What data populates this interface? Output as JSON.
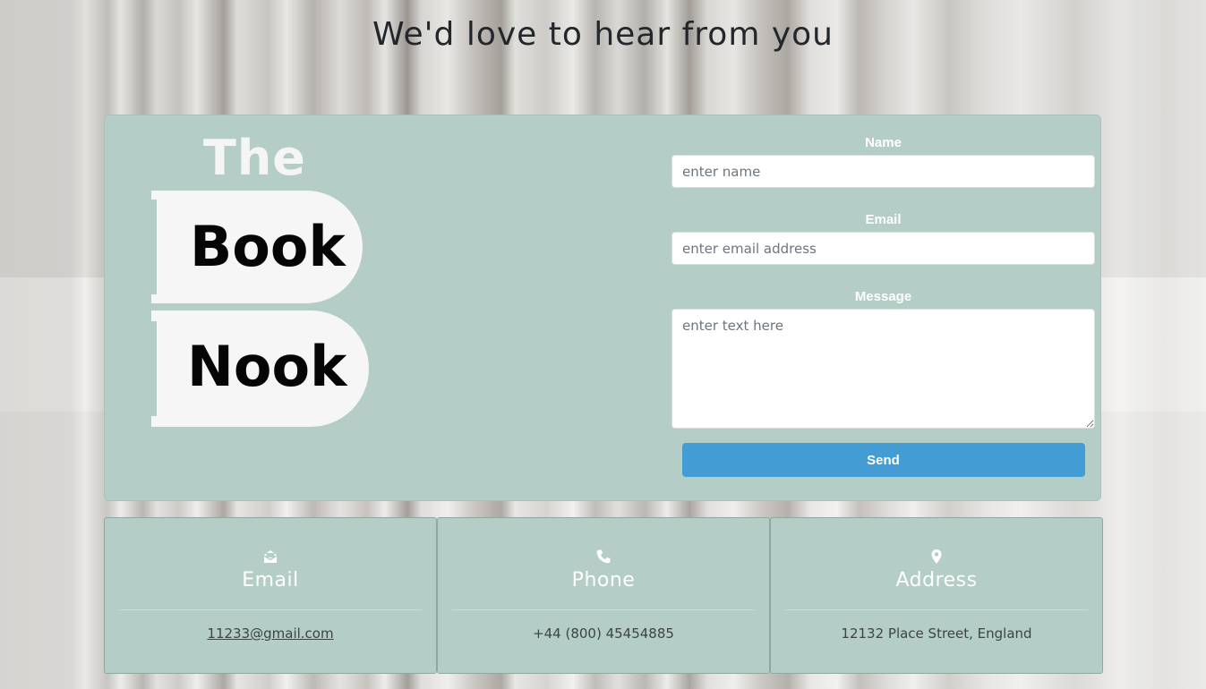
{
  "page": {
    "title": "We'd love to hear from you"
  },
  "logo": {
    "line1": "The",
    "line2": "Book",
    "line3": "Nook"
  },
  "form": {
    "name_label": "Name",
    "name_placeholder": "enter name",
    "email_label": "Email",
    "email_placeholder": "enter email address",
    "message_label": "Message",
    "message_placeholder": "enter text here",
    "send_label": "Send"
  },
  "info": {
    "email": {
      "heading": "Email",
      "value": "11233@gmail.com",
      "icon": "envelope-open-icon"
    },
    "phone": {
      "heading": "Phone",
      "value": "+44 (800) 45454885",
      "icon": "phone-icon"
    },
    "address": {
      "heading": "Address",
      "value": "12132 Place Street, England",
      "icon": "map-pin-icon"
    }
  },
  "colors": {
    "card_background": "#b4cdc6",
    "send_button": "#439cd3",
    "title_text": "#23272b"
  }
}
